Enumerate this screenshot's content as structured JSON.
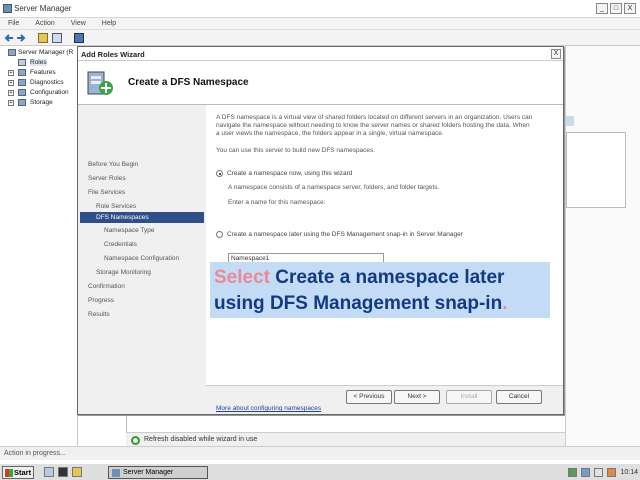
{
  "window": {
    "title": "Server Manager",
    "min": "_",
    "max": "□",
    "close": "X"
  },
  "menu": [
    "File",
    "Action",
    "View",
    "Help"
  ],
  "tree": {
    "root": "Server Manager (R",
    "items": [
      "Roles",
      "Features",
      "Diagnostics",
      "Configuration",
      "Storage"
    ]
  },
  "wizard": {
    "title": "Add Roles Wizard",
    "close": "X",
    "header": "Create a DFS Namespace",
    "steps": [
      "Before You Begin",
      "Server Roles",
      "File Services",
      "Role Services",
      "DFS Namespaces",
      "Namespace Type",
      "Credentials",
      "Namespace Configuration",
      "Storage Monitoring",
      "Confirmation",
      "Progress",
      "Results"
    ],
    "active_step": "DFS Namespaces",
    "intro": [
      "A DFS namespace is a virtual view of shared folders located on different servers in an organization. Users can",
      "navigate the namespace without needing to know the server names or shared folders hosting the data. When",
      "a user views the namespace, the folders appear in a single, virtual namespace."
    ],
    "can_use": "You can use this server to build new DFS namespaces.",
    "option_now": "Create a namespace now, using this wizard",
    "option_now_desc": "A namespace consists of a namespace server, folders, and folder targets.",
    "name_label": "Enter a name for this namespace:",
    "name_value": "Namespace1",
    "option_later": "Create a namespace later using the DFS Management snap-in in Server Manager",
    "more_link": "More about configuring namespaces",
    "buttons": {
      "previous": "< Previous",
      "next": "Next >",
      "install": "Install",
      "cancel": "Cancel"
    }
  },
  "callout": {
    "keyword": "Select",
    "line1": "Create a namespace later",
    "line2": "using DFS Management snap-in",
    "period": "."
  },
  "refresh_text": "Refresh disabled while wizard in use",
  "status_text": "Action in progress...",
  "taskbar": {
    "start": "Start",
    "task": "Server Manager",
    "clock": "10:14"
  }
}
